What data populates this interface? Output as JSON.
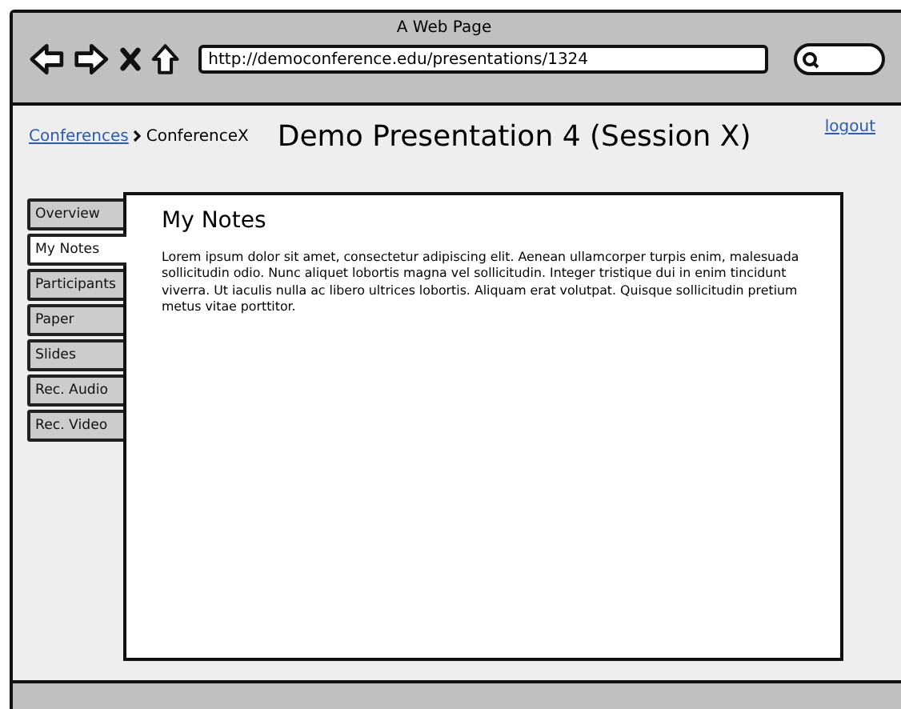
{
  "window": {
    "title": "A Web Page"
  },
  "address_bar": {
    "value": "http://democonference.edu/presentations/1324"
  },
  "breadcrumb": [
    {
      "label": "Conferences",
      "kind": "link"
    },
    {
      "label": "ConferenceX",
      "kind": "current"
    }
  ],
  "page_title": "Demo Presentation 4 (Session X)",
  "logout": "logout",
  "tabs": [
    {
      "label": "Overview",
      "selected": false
    },
    {
      "label": "My Notes",
      "selected": true
    },
    {
      "label": "Participants",
      "selected": false
    },
    {
      "label": "Paper",
      "selected": false
    },
    {
      "label": "Slides",
      "selected": false
    },
    {
      "label": "Rec. Audio",
      "selected": false
    },
    {
      "label": "Rec. Video",
      "selected": false
    }
  ],
  "panel": {
    "heading": "My Notes",
    "text": "Lorem ipsum dolor sit amet, consectetur adipiscing elit. Aenean ullamcorper turpis enim, malesuada sollicitudin odio. Nunc aliquet lobortis magna vel sollicitudin. Integer tristique dui in enim tincidunt viverra. Ut iaculis nulla ac libero ultrices lobortis. Aliquam erat volutpat. Quisque sollicitudin pretium metus vitae porttitor."
  }
}
